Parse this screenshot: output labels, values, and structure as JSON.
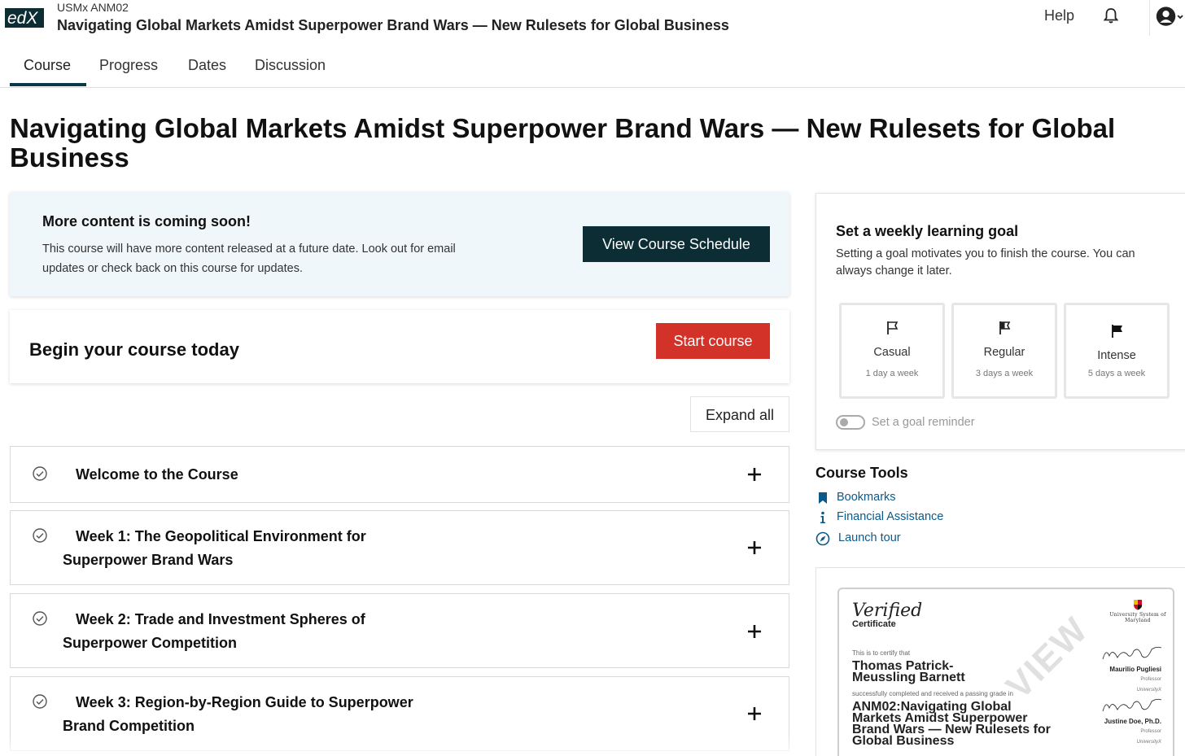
{
  "header": {
    "logo_text": "edX",
    "course_org": "USMx ANM02",
    "course_title": "Navigating Global Markets Amidst Superpower Brand Wars — New Rulesets for Global Business",
    "help_label": "Help"
  },
  "tabs": [
    {
      "label": "Course"
    },
    {
      "label": "Progress"
    },
    {
      "label": "Dates"
    },
    {
      "label": "Discussion"
    }
  ],
  "page_title": "Navigating Global Markets Amidst Superpower Brand Wars — New Rulesets for Global Business",
  "alert": {
    "title": "More content is coming soon!",
    "text": "This course will have more content released at a future date. Look out for email updates or check back on this course for updates.",
    "button": "View Course Schedule"
  },
  "begin": {
    "title": "Begin your course today",
    "button": "Start course"
  },
  "expand_all": "Expand all",
  "sections": [
    {
      "title": "Welcome to the Course"
    },
    {
      "title": "Week 1: The Geopolitical Environment for Superpower Brand Wars"
    },
    {
      "title": "Week 2: Trade and Investment Spheres of Superpower Competition"
    },
    {
      "title": "Week 3: Region-by-Region Guide to Superpower Brand Competition"
    }
  ],
  "goal": {
    "title": "Set a weekly learning goal",
    "text": "Setting a goal motivates you to finish the course. You can always change it later.",
    "options": [
      {
        "name": "Casual",
        "sub": "1 day a week"
      },
      {
        "name": "Regular",
        "sub": "3 days a week"
      },
      {
        "name": "Intense",
        "sub": "5 days a week"
      }
    ],
    "reminder_label": "Set a goal reminder"
  },
  "tools": {
    "title": "Course Tools",
    "items": [
      {
        "label": "Bookmarks",
        "icon": "bookmark-icon"
      },
      {
        "label": "Financial Assistance",
        "icon": "info-icon"
      },
      {
        "label": "Launch tour",
        "icon": "compass-icon"
      }
    ]
  },
  "certificate": {
    "verified": "Verified",
    "sub": "Certificate",
    "university": "University System of Maryland",
    "certify_text": "This is to certify that",
    "name": "Thomas Patrick-Meussling Barnett",
    "completed_text": "successfully completed and received a passing grade in",
    "course": "ANM02:Navigating Global Markets Amidst Superpower Brand Wars — New Rulesets for Global Business",
    "watermark": "VIEW",
    "signers": [
      {
        "name": "Maurilio Pugliesi",
        "role": "Professor",
        "org": "UniversityX"
      },
      {
        "name": "Justine Doe, Ph.D.",
        "role": "Professor",
        "org": "UniversityX"
      }
    ]
  },
  "colors": {
    "primary_dark": "#0d2d35",
    "accent_red": "#d23228",
    "link_blue": "#0b5a8a",
    "alert_bg": "#eff7fa"
  }
}
